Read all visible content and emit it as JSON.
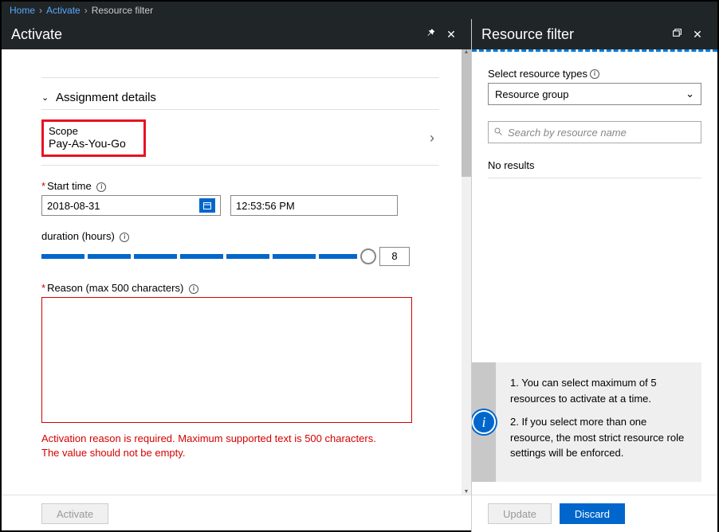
{
  "breadcrumb": {
    "home": "Home",
    "activate": "Activate",
    "filter": "Resource filter"
  },
  "left": {
    "title": "Activate",
    "section_title": "Assignment details",
    "scope_label": "Scope",
    "scope_value": "Pay-As-You-Go",
    "start_time_label": "Start time",
    "date_value": "2018-08-31",
    "time_value": "12:53:56 PM",
    "duration_label": "duration (hours)",
    "duration_value": "8",
    "reason_label": "Reason (max 500 characters)",
    "error_line1": "Activation reason is required. Maximum supported text is 500 characters.",
    "error_line2": "The value should not be empty.",
    "activate_btn": "Activate"
  },
  "right": {
    "title": "Resource filter",
    "select_label": "Select resource types",
    "select_value": "Resource group",
    "search_placeholder": "Search by resource name",
    "no_results": "No results",
    "hint1": "1. You can select maximum of 5 resources to activate at a time.",
    "hint2": "2. If you select more than one resource, the most strict resource role settings will be enforced.",
    "update_btn": "Update",
    "discard_btn": "Discard"
  }
}
